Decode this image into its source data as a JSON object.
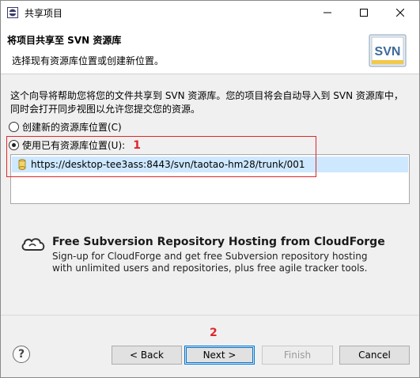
{
  "window": {
    "title": "共享项目"
  },
  "header": {
    "title": "将项目共享至 SVN 资源库",
    "description": "选择现有资源库位置或创建新位置。",
    "logo_text": "SVN"
  },
  "content": {
    "intro": "这个向导将帮助您将您的文件共享到 SVN 资源库。您的项目将会自动导入到 SVN 资源库中，同时会打开同步视图以允许您提交您的资源。",
    "radio_create": {
      "label": "创建新的资源库位置(C)",
      "checked": false
    },
    "radio_existing": {
      "label": "使用已有资源库位置(U):",
      "checked": true
    },
    "annotation_1": "1",
    "repositories": [
      {
        "url": "https://desktop-tee3ass:8443/svn/taotao-hm28/trunk/001",
        "selected": true
      }
    ]
  },
  "cloudforge": {
    "title": "Free Subversion Repository Hosting from CloudForge",
    "description": "Sign-up for CloudForge and get free Subversion repository hosting with unlimited users and repositories, plus free agile tracker tools."
  },
  "footer": {
    "annotation_2": "2",
    "help_label": "?",
    "back_label": "< Back",
    "next_label": "Next >",
    "finish_label": "Finish",
    "cancel_label": "Cancel"
  },
  "colors": {
    "accent": "#0078d7",
    "selection": "#cde8ff",
    "annotation_red": "#e0262b"
  }
}
